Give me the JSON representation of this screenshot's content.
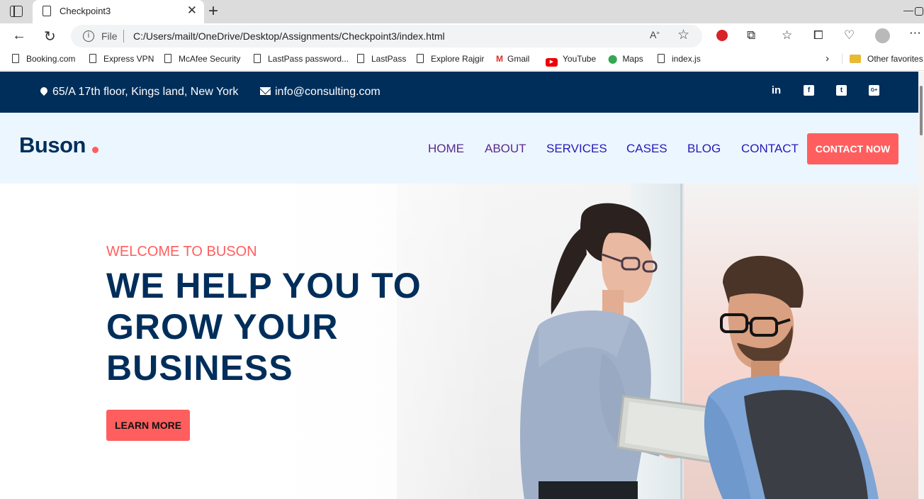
{
  "browser": {
    "tab_title": "Checkpoint3",
    "tab_close": "✕",
    "new_tab": "+",
    "file_label": "File",
    "url": "C:/Users/mailt/OneDrive/Desktop/Assignments/Checkpoint3/index.html",
    "bookmarks": [
      {
        "label": "Booking.com",
        "icon": "page-icon"
      },
      {
        "label": "Express VPN",
        "icon": "page-icon"
      },
      {
        "label": "McAfee Security",
        "icon": "page-icon"
      },
      {
        "label": "LastPass password...",
        "icon": "page-icon"
      },
      {
        "label": "LastPass",
        "icon": "page-icon"
      },
      {
        "label": "Explore Rajgir",
        "icon": "page-icon"
      },
      {
        "label": "Gmail",
        "icon": "gmail-icon"
      },
      {
        "label": "YouTube",
        "icon": "youtube-icon"
      },
      {
        "label": "Maps",
        "icon": "maps-icon"
      },
      {
        "label": "index.js",
        "icon": "page-icon"
      }
    ],
    "other_favorites": "Other favorites"
  },
  "topbar": {
    "address": "65/A 17th floor, Kings land, New York",
    "email": "info@consulting.com",
    "socials": [
      "in",
      "f",
      "t",
      "G+"
    ]
  },
  "header": {
    "logo": "Buson",
    "nav": [
      {
        "label": "HOME",
        "visited": true
      },
      {
        "label": "ABOUT",
        "visited": true
      },
      {
        "label": "SERVICES",
        "visited": false
      },
      {
        "label": "CASES",
        "visited": false
      },
      {
        "label": "BLOG",
        "visited": false
      },
      {
        "label": "CONTACT",
        "visited": false
      }
    ],
    "cta": "CONTACT NOW"
  },
  "hero": {
    "welcome": "WELCOME TO BUSON",
    "headline_lines": [
      "WE HELP YOU TO",
      "GROW YOUR",
      "BUSINESS"
    ],
    "button": "LEARN MORE"
  },
  "colors": {
    "navy": "#002e5b",
    "coral": "#ff5e5e",
    "header_bg": "#ecf6ff",
    "link": "#2419b8",
    "visited": "#5a2a8c"
  }
}
